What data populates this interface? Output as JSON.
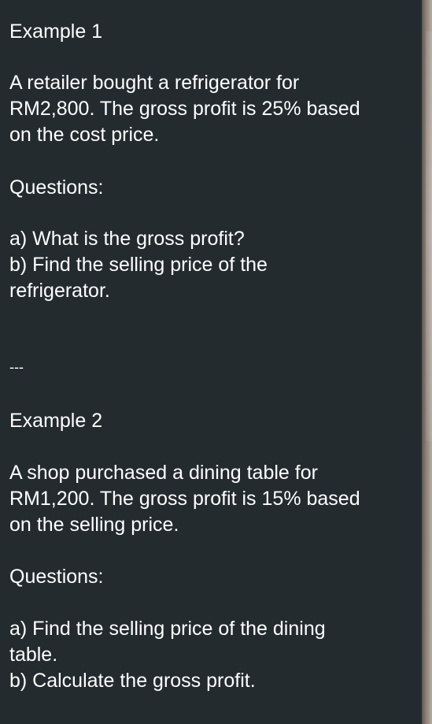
{
  "message": {
    "example1": {
      "heading": "Example 1",
      "body": [
        "A retailer bought a refrigerator for",
        "RM2,800. The gross profit is 25% based",
        "on the cost price."
      ],
      "questions_label": "Questions:",
      "questions": [
        "a) What is the gross profit?",
        "b) Find the selling price of the",
        "refrigerator."
      ]
    },
    "separator": "---",
    "example2": {
      "heading": "Example 2",
      "body": [
        "A shop purchased a dining table for",
        "RM1,200. The gross profit is 15% based",
        "on the selling price."
      ],
      "questions_label": "Questions:",
      "questions": [
        "a) Find the selling price of the dining",
        "table.",
        "b) Calculate the gross profit."
      ]
    }
  }
}
